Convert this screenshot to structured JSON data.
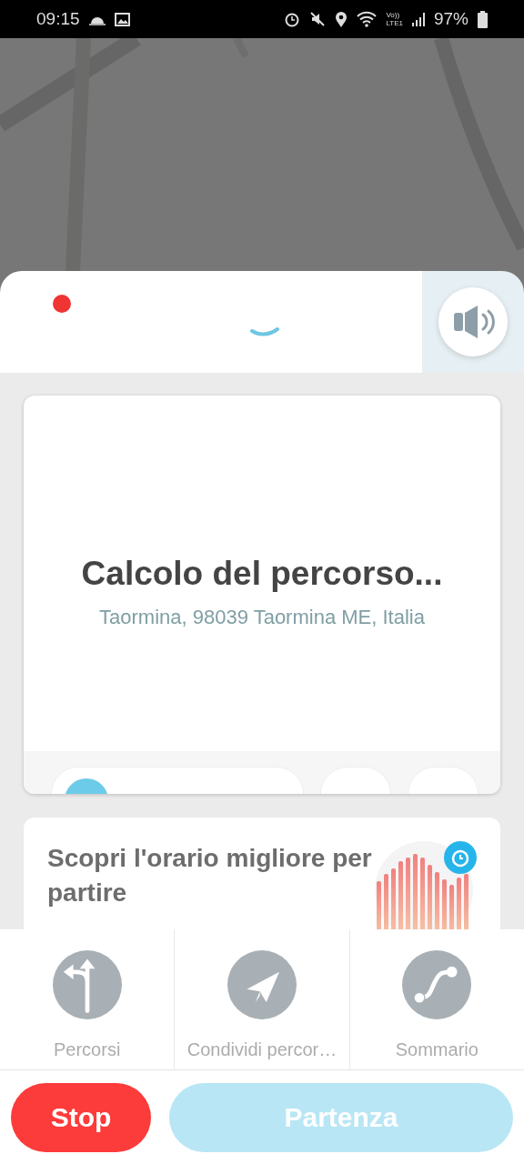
{
  "status_bar": {
    "time": "09:15",
    "network": [
      "Vo))",
      "LTE1"
    ],
    "battery": "97%"
  },
  "route_card": {
    "title": "Calcolo del percorso...",
    "address": "Taormina, 98039 Taormina ME, Italia"
  },
  "promo_card": {
    "title": "Scopri l'orario migliore per partire"
  },
  "actions": [
    {
      "kind": "routes",
      "label": "Percorsi"
    },
    {
      "kind": "share",
      "label": "Condividi percor…"
    },
    {
      "kind": "summary",
      "label": "Sommario"
    }
  ],
  "buttons": [
    {
      "kind": "stop",
      "label": "Stop",
      "disabled": false
    },
    {
      "kind": "go",
      "label": "Partenza",
      "disabled": true
    }
  ]
}
